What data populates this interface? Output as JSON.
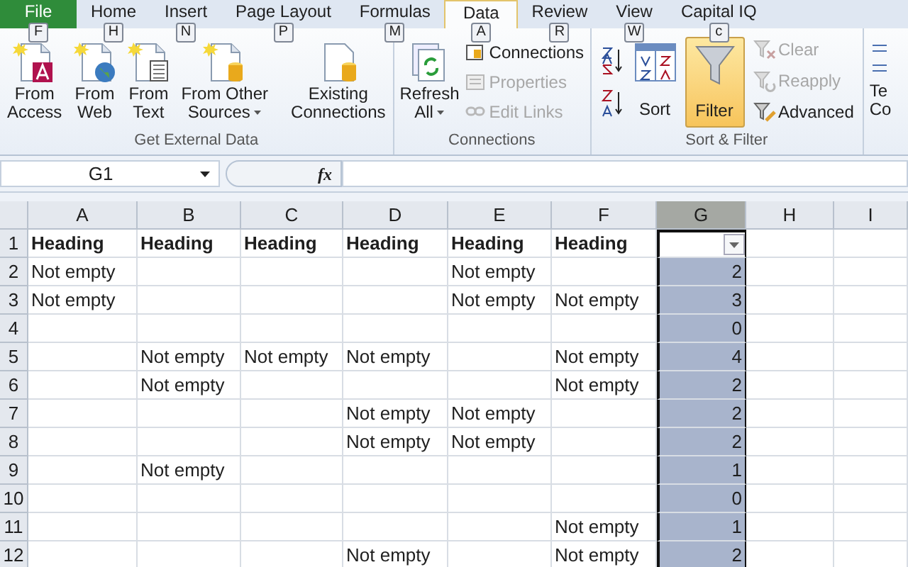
{
  "tabs": [
    {
      "label": "File",
      "key": "F",
      "kind": "file",
      "selected": false
    },
    {
      "label": "Home",
      "key": "H",
      "kind": "tab",
      "selected": false
    },
    {
      "label": "Insert",
      "key": "N",
      "kind": "tab",
      "selected": false
    },
    {
      "label": "Page Layout",
      "key": "P",
      "kind": "tab",
      "selected": false
    },
    {
      "label": "Formulas",
      "key": "M",
      "kind": "tab",
      "selected": false
    },
    {
      "label": "Data",
      "key": "A",
      "kind": "tab",
      "selected": true
    },
    {
      "label": "Review",
      "key": "R",
      "kind": "tab",
      "selected": false
    },
    {
      "label": "View",
      "key": "W",
      "kind": "tab",
      "selected": false
    },
    {
      "label": "Capital IQ",
      "key": "c",
      "kind": "tab",
      "selected": false
    }
  ],
  "ribbon": {
    "get_external_data": {
      "label": "Get External Data",
      "buttons": [
        {
          "lines": [
            "From",
            "Access"
          ],
          "kind": "access",
          "dropdown": false
        },
        {
          "lines": [
            "From",
            "Web"
          ],
          "kind": "web",
          "dropdown": false
        },
        {
          "lines": [
            "From",
            "Text"
          ],
          "kind": "text",
          "dropdown": false
        },
        {
          "lines": [
            "From Other",
            "Sources"
          ],
          "kind": "other",
          "dropdown": true
        },
        {
          "lines": [
            "Existing",
            "Connections"
          ],
          "kind": "existing",
          "dropdown": false
        }
      ]
    },
    "connections": {
      "label": "Connections",
      "refresh": {
        "lines": [
          "Refresh",
          "All"
        ],
        "dropdown": true
      },
      "items": [
        {
          "label": "Connections",
          "disabled": false
        },
        {
          "label": "Properties",
          "disabled": true
        },
        {
          "label": "Edit Links",
          "disabled": true
        }
      ]
    },
    "sort_filter": {
      "label": "Sort & Filter",
      "sort": "Sort",
      "filter": {
        "label": "Filter",
        "selected": true
      },
      "items": [
        {
          "label": "Clear",
          "disabled": true
        },
        {
          "label": "Reapply",
          "disabled": true
        },
        {
          "label": "Advanced",
          "disabled": false
        }
      ]
    },
    "cut": [
      "Te",
      "Co"
    ]
  },
  "formula_bar": {
    "name_box": "G1",
    "fx": "fx"
  },
  "columns": [
    {
      "label": "A",
      "selected": false,
      "filter": false
    },
    {
      "label": "B",
      "selected": false,
      "filter": false
    },
    {
      "label": "C",
      "selected": false,
      "filter": false
    },
    {
      "label": "D",
      "selected": false,
      "filter": false
    },
    {
      "label": "E",
      "selected": false,
      "filter": false
    },
    {
      "label": "F",
      "selected": false,
      "filter": false
    },
    {
      "label": "G",
      "selected": true,
      "filter": true
    },
    {
      "label": "H",
      "selected": false,
      "filter": false
    },
    {
      "label": "I",
      "selected": false,
      "filter": false
    }
  ],
  "rows": [
    {
      "label": "1",
      "cells": [
        "Heading",
        "Heading",
        "Heading",
        "Heading",
        "Heading",
        "Heading",
        null,
        null,
        null
      ]
    },
    {
      "label": "2",
      "cells": [
        "Not empty",
        null,
        null,
        null,
        "Not empty",
        null,
        "2",
        null,
        null
      ]
    },
    {
      "label": "3",
      "cells": [
        "Not empty",
        null,
        null,
        null,
        "Not empty",
        "Not empty",
        "3",
        null,
        null
      ]
    },
    {
      "label": "4",
      "cells": [
        null,
        null,
        null,
        null,
        null,
        null,
        "0",
        null,
        null
      ]
    },
    {
      "label": "5",
      "cells": [
        null,
        "Not empty",
        "Not empty",
        "Not empty",
        null,
        "Not empty",
        "4",
        null,
        null
      ]
    },
    {
      "label": "6",
      "cells": [
        null,
        "Not empty",
        null,
        null,
        null,
        "Not empty",
        "2",
        null,
        null
      ]
    },
    {
      "label": "7",
      "cells": [
        null,
        null,
        null,
        "Not empty",
        "Not empty",
        null,
        "2",
        null,
        null
      ]
    },
    {
      "label": "8",
      "cells": [
        null,
        null,
        null,
        "Not empty",
        "Not empty",
        null,
        "2",
        null,
        null
      ]
    },
    {
      "label": "9",
      "cells": [
        null,
        "Not empty",
        null,
        null,
        null,
        null,
        "1",
        null,
        null
      ]
    },
    {
      "label": "10",
      "cells": [
        null,
        null,
        null,
        null,
        null,
        null,
        "0",
        null,
        null
      ]
    },
    {
      "label": "11",
      "cells": [
        null,
        null,
        null,
        null,
        null,
        "Not empty",
        "1",
        null,
        null
      ]
    },
    {
      "label": "12",
      "cells": [
        null,
        null,
        null,
        "Not empty",
        null,
        "Not empty",
        "2",
        null,
        null
      ]
    }
  ]
}
